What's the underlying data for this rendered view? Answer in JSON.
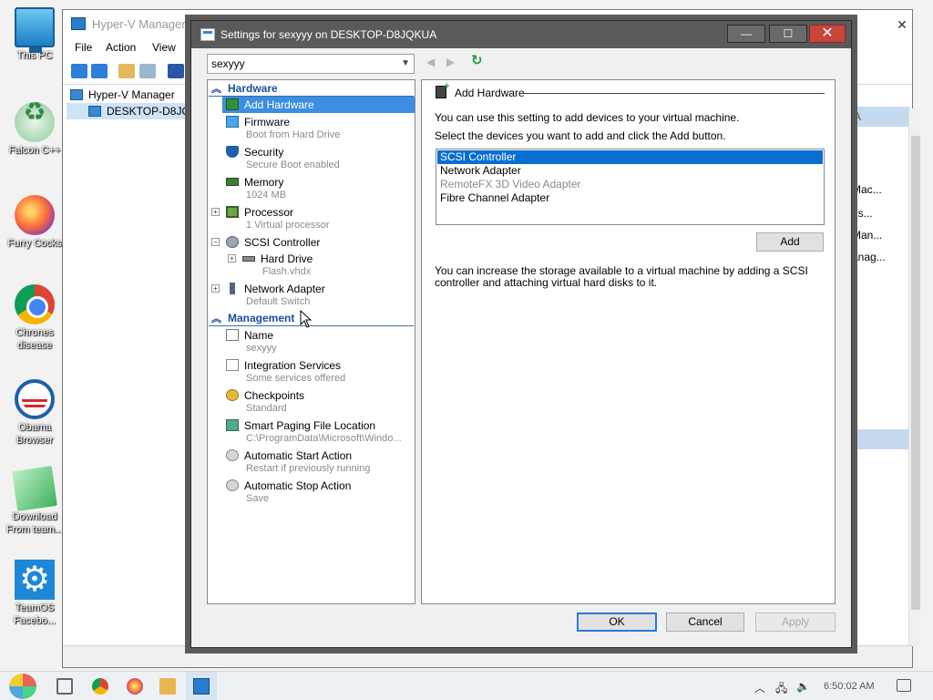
{
  "desktop": {
    "icons": [
      {
        "label": "This PC"
      },
      {
        "label": "Falcon C++"
      },
      {
        "label": "Furry Cocks"
      },
      {
        "label": "Chrones disease"
      },
      {
        "label": "Obama Browser"
      },
      {
        "label": "Download From team..."
      },
      {
        "label": "TeamOS Facebo..."
      }
    ]
  },
  "hyperv": {
    "title": "Hyper-V Manager",
    "menu": [
      "File",
      "Action",
      "View"
    ],
    "tree": [
      {
        "label": "Hyper-V Manager"
      },
      {
        "label": "DESKTOP-D8JQKUA"
      }
    ],
    "actions": [
      "A",
      "Mac...",
      "gs...",
      "Man...",
      "anag...",
      "r"
    ]
  },
  "dialog": {
    "title": "Settings for sexyyy on DESKTOP-D8JQKUA",
    "close_glyph": "✕",
    "vm_selected": "sexyyy",
    "sections": {
      "hardware": "Hardware",
      "management": "Management"
    },
    "hardware_items": [
      {
        "main": "Add Hardware",
        "sub": ""
      },
      {
        "main": "Firmware",
        "sub": "Boot from Hard Drive"
      },
      {
        "main": "Security",
        "sub": "Secure Boot enabled"
      },
      {
        "main": "Memory",
        "sub": "1024 MB"
      },
      {
        "main": "Processor",
        "sub": "1 Virtual processor"
      },
      {
        "main": "SCSI Controller",
        "sub": ""
      },
      {
        "main": "Hard Drive",
        "sub": "Flash.vhdx"
      },
      {
        "main": "Network Adapter",
        "sub": "Default Switch"
      }
    ],
    "management_items": [
      {
        "main": "Name",
        "sub": "sexyyy"
      },
      {
        "main": "Integration Services",
        "sub": "Some services offered"
      },
      {
        "main": "Checkpoints",
        "sub": "Standard"
      },
      {
        "main": "Smart Paging File Location",
        "sub": "C:\\ProgramData\\Microsoft\\Windo..."
      },
      {
        "main": "Automatic Start Action",
        "sub": "Restart if previously running"
      },
      {
        "main": "Automatic Stop Action",
        "sub": "Save"
      }
    ],
    "panel": {
      "header": "Add Hardware",
      "intro": "You can use this setting to add devices to your virtual machine.",
      "instruction": "Select the devices you want to add and click the Add button.",
      "devices": [
        {
          "label": "SCSI Controller",
          "state": "selected"
        },
        {
          "label": "Network Adapter",
          "state": "normal"
        },
        {
          "label": "RemoteFX 3D Video Adapter",
          "state": "disabled"
        },
        {
          "label": "Fibre Channel Adapter",
          "state": "normal"
        }
      ],
      "add_label": "Add",
      "storage_note": "You can increase the storage available to a virtual machine by adding a SCSI controller and attaching virtual hard disks to it."
    },
    "buttons": {
      "ok": "OK",
      "cancel": "Cancel",
      "apply": "Apply"
    }
  },
  "taskbar": {
    "clock": "6:50:02 AM"
  },
  "colors": {
    "selection": "#3b8ee2",
    "section_header": "#1a4fa0",
    "title_bar": "#5a5a5a",
    "close_button": "#c8453c"
  }
}
